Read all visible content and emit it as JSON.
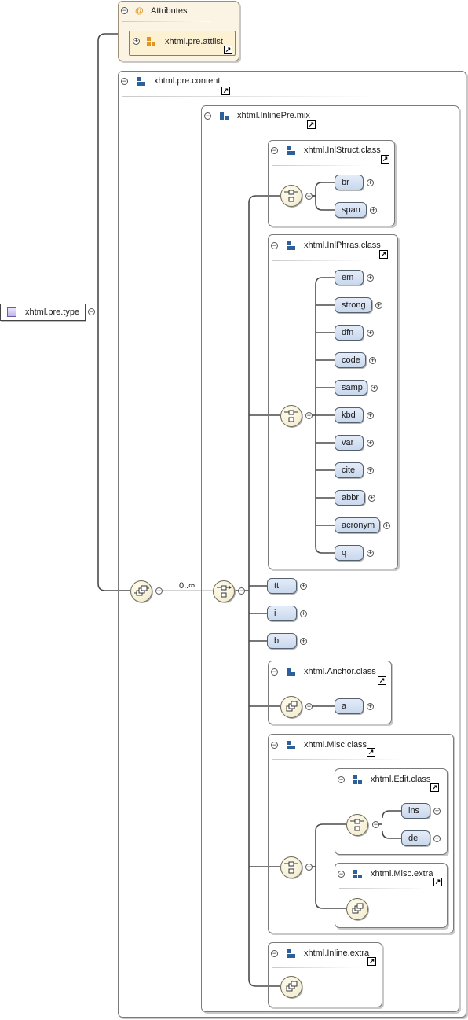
{
  "root": {
    "label": "xhtml.pre.type"
  },
  "attributes": {
    "icon_label": "@",
    "title": "Attributes",
    "attlist": "xhtml.pre.attlist"
  },
  "content_group": {
    "title": "xhtml.pre.content"
  },
  "sequence": {
    "occurrence": "0..∞"
  },
  "inlinepre_mix": {
    "title": "xhtml.InlinePre.mix"
  },
  "inlstruct": {
    "title": "xhtml.InlStruct.class",
    "elements": [
      "br",
      "span"
    ]
  },
  "inlphras": {
    "title": "xhtml.InlPhras.class",
    "elements": [
      "em",
      "strong",
      "dfn",
      "code",
      "samp",
      "kbd",
      "var",
      "cite",
      "abbr",
      "acronym",
      "q"
    ]
  },
  "direct_elements": [
    "tt",
    "i",
    "b"
  ],
  "anchor": {
    "title": "xhtml.Anchor.class",
    "elements": [
      "a"
    ]
  },
  "misc": {
    "title": "xhtml.Misc.class"
  },
  "edit": {
    "title": "xhtml.Edit.class",
    "elements": [
      "ins",
      "del"
    ]
  },
  "misc_extra": {
    "title": "xhtml.Misc.extra"
  },
  "inline_extra": {
    "title": "xhtml.Inline.extra"
  }
}
